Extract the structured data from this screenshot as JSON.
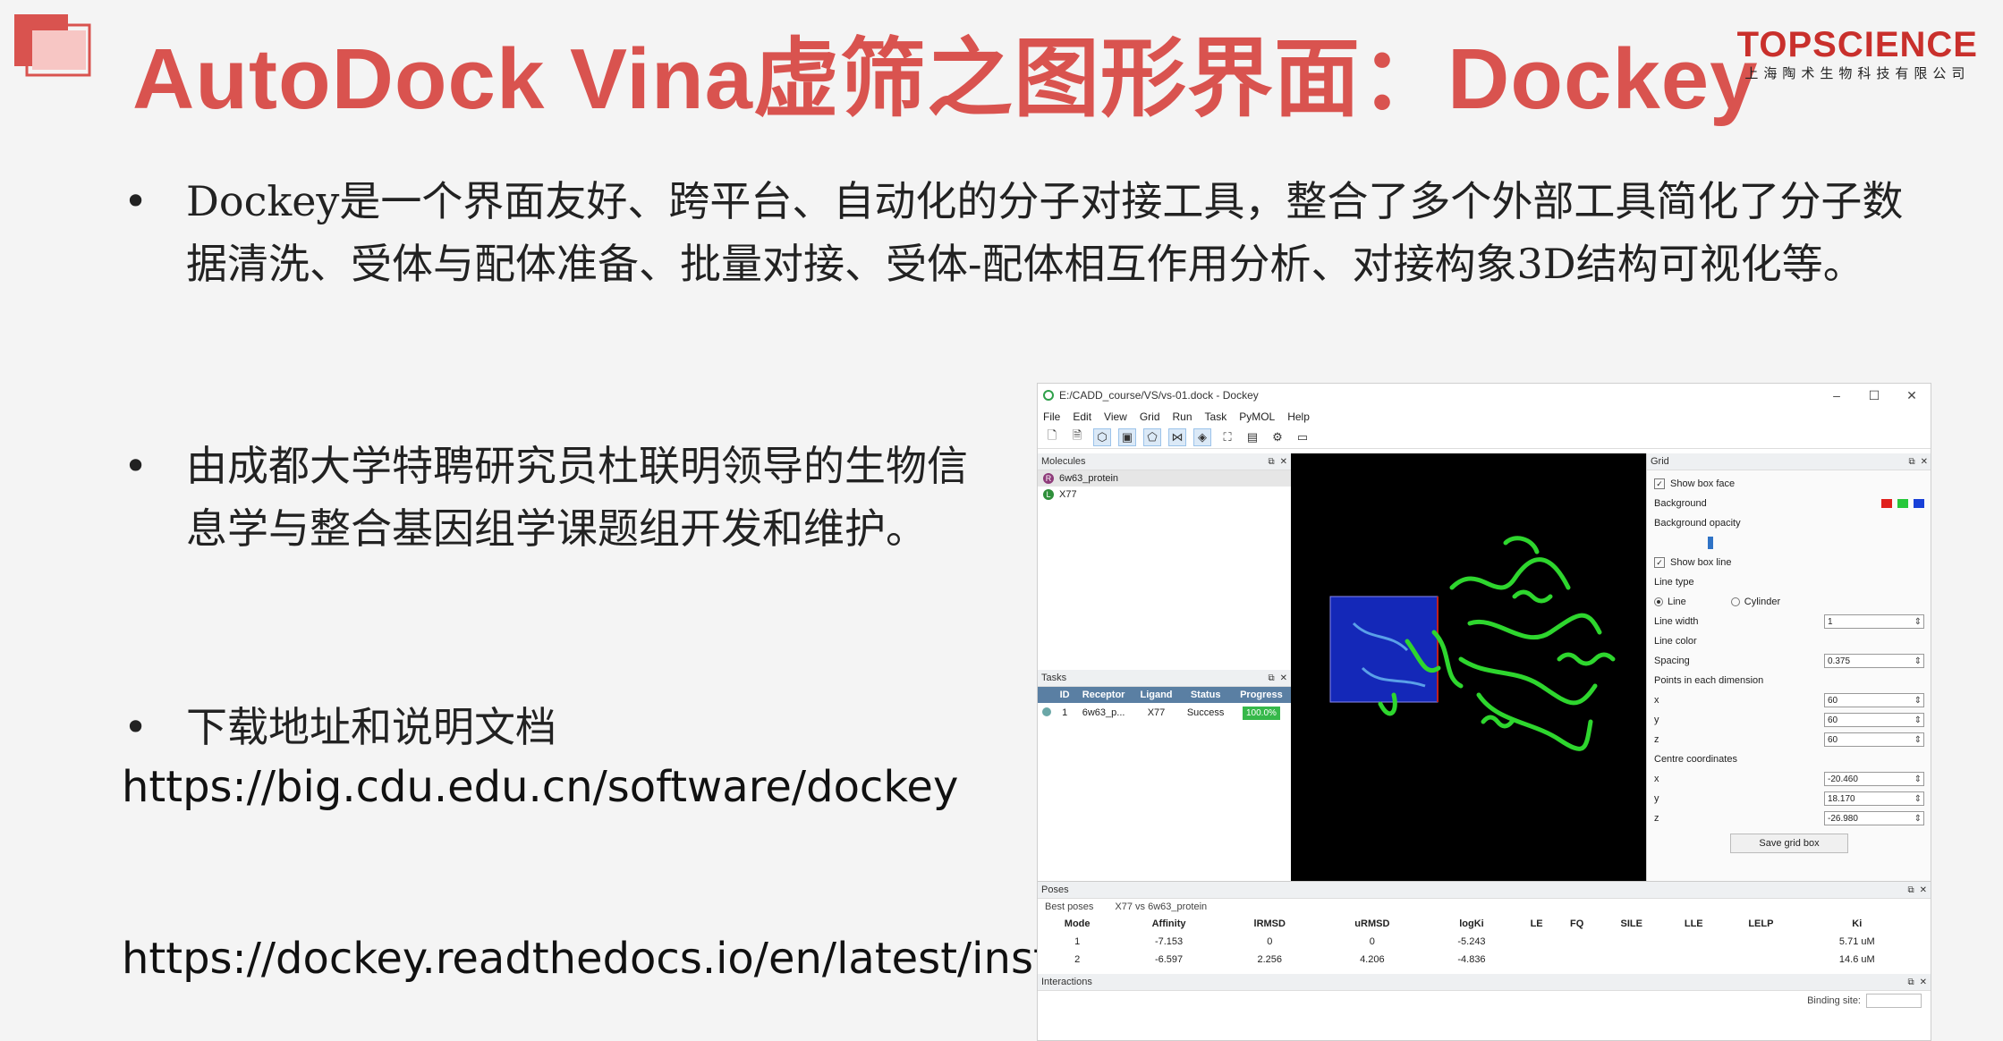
{
  "slide": {
    "title": "AutoDock Vina虚筛之图形界面：Dockey",
    "brand_name": "TOPSCIENCE",
    "brand_sub": "上海陶术生物科技有限公司",
    "bullets": [
      "Dockey是一个界面友好、跨平台、自动化的分子对接工具，整合了多个外部工具简化了分子数据清洗、受体与配体准备、批量对接、受体-配体相互作用分析、对接构象3D结构可视化等。",
      "由成都大学特聘研究员杜联明领导的生物信息学与整合基因组学课题组开发和维护。",
      "下载地址和说明文档"
    ],
    "bullet_char": "•",
    "link1": "https://big.cdu.edu.cn/software/dockey",
    "link2": "https://dockey.readthedocs.io/en/latest/installation.html"
  },
  "app": {
    "window_title": "E:/CADD_course/VS/vs-01.dock - Dockey",
    "window_controls": [
      "–",
      "☐",
      "✕"
    ],
    "menu": [
      "File",
      "Edit",
      "View",
      "Grid",
      "Run",
      "Task",
      "PyMOL",
      "Help"
    ],
    "toolbar_icons": [
      "new-file-icon",
      "open-file-icon",
      "cartoon-icon",
      "box-icon",
      "surface-icon",
      "share-icon",
      "cube-icon",
      "crop-icon",
      "image-icon",
      "settings-icon",
      "terminal-icon"
    ],
    "molecules": {
      "title": "Molecules",
      "items": [
        {
          "badge": "R",
          "name": "6w63_protein",
          "color": "#8e3b7a"
        },
        {
          "badge": "L",
          "name": "X77",
          "color": "#2f8f3a"
        }
      ]
    },
    "tasks": {
      "title": "Tasks",
      "columns": [
        "ID",
        "Receptor",
        "Ligand",
        "Status",
        "Progress"
      ],
      "rows": [
        {
          "id": "1",
          "receptor": "6w63_p...",
          "ligand": "X77",
          "status": "Success",
          "progress": "100.0%"
        }
      ]
    },
    "grid": {
      "title": "Grid",
      "show_box_face": "Show box face",
      "background": "Background",
      "background_colors": [
        "#e0201c",
        "#27c83a",
        "#1840d8"
      ],
      "background_opacity": "Background opacity",
      "show_box_line": "Show box line",
      "line_type": "Line type",
      "line_option": "Line",
      "cylinder_option": "Cylinder",
      "line_width_label": "Line width",
      "line_width": "1",
      "line_color": "Line color",
      "spacing_label": "Spacing",
      "spacing": "0.375",
      "points_label": "Points in each dimension",
      "points": {
        "x": "60",
        "y": "60",
        "z": "60"
      },
      "centre_label": "Centre coordinates",
      "centre": {
        "x": "-20.460",
        "y": "18.170",
        "z": "-26.980"
      },
      "axis_labels": {
        "x": "x",
        "y": "y",
        "z": "z"
      },
      "save_button": "Save grid box"
    },
    "poses": {
      "title": "Poses",
      "tab_best": "Best poses",
      "tab_context": "X77 vs 6w63_protein",
      "columns": [
        "Mode",
        "Affinity",
        "lRMSD",
        "uRMSD",
        "logKi",
        "LE",
        "FQ",
        "SILE",
        "LLE",
        "LELP",
        "Ki"
      ],
      "rows": [
        [
          "1",
          "-7.153",
          "0",
          "0",
          "-5.243",
          "",
          "",
          "",
          "",
          "",
          "5.71 uM"
        ],
        [
          "2",
          "-6.597",
          "2.256",
          "4.206",
          "-4.836",
          "",
          "",
          "",
          "",
          "",
          "14.6 uM"
        ]
      ]
    },
    "interactions": {
      "title": "Interactions",
      "binding_site_label": "Binding site:"
    },
    "panel_buttons": {
      "float": "⧉",
      "close": "✕"
    }
  }
}
